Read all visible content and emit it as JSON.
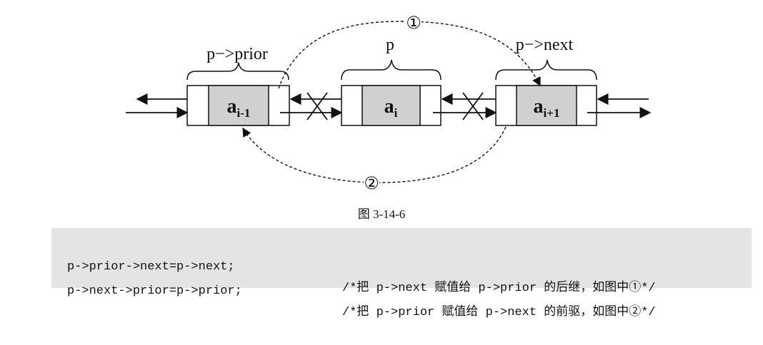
{
  "diagram": {
    "labels": {
      "left": "p−>prior",
      "middle": "p",
      "right": "p−>next"
    },
    "nodes": [
      {
        "base": "a",
        "sub": "i-1"
      },
      {
        "base": "a",
        "sub": "i"
      },
      {
        "base": "a",
        "sub": "i+1"
      }
    ],
    "step_labels": {
      "top": "①",
      "bottom": "②"
    },
    "colors": {
      "node_fill": "#d0d0d0",
      "line": "#111111",
      "code_bg": "#e4e4e4"
    }
  },
  "caption": "图 3-14-6",
  "code": [
    {
      "stmt": "p->prior->next=p->next;",
      "comment": "/*把 p->next 赋值给 p->prior 的后继，如图中①*/"
    },
    {
      "stmt": "p->next->prior=p->prior;",
      "comment": "/*把 p->prior 赋值给 p->next 的前驱，如图中②*/"
    }
  ]
}
